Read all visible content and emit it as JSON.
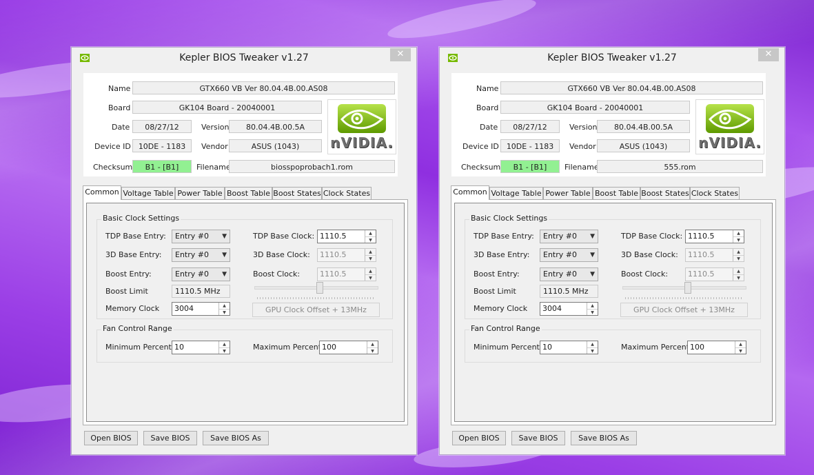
{
  "windows": [
    {
      "title": "Kepler BIOS Tweaker v1.27",
      "close_glyph": "✕",
      "info": {
        "name_label": "Name",
        "name_value": "GTX660 VB Ver 80.04.4B.00.AS08",
        "board_label": "Board",
        "board_value": "GK104 Board - 20040001",
        "date_label": "Date",
        "date_value": "08/27/12",
        "version_label": "Version",
        "version_value": "80.04.4B.00.5A",
        "device_label": "Device ID",
        "device_value": "10DE - 1183",
        "vendor_label": "Vendor",
        "vendor_value": "ASUS (1043)",
        "checksum_label": "Checksum",
        "checksum_value": "B1 - [B1]",
        "filename_label": "Filename",
        "filename_value": "biosspoprobach1.rom",
        "logo_text": "nVIDIA."
      },
      "tabs": [
        "Common",
        "Voltage Table",
        "Power Table",
        "Boost Table",
        "Boost States",
        "Clock States"
      ],
      "basic": {
        "group_title": "Basic Clock Settings",
        "tdp_entry_label": "TDP Base Entry:",
        "tdp_entry_value": "Entry #0",
        "base3d_entry_label": "3D Base Entry:",
        "base3d_entry_value": "Entry #0",
        "boost_entry_label": "Boost Entry:",
        "boost_entry_value": "Entry #0",
        "boost_limit_label": "Boost Limit",
        "boost_limit_value": "1110.5 MHz",
        "memory_clock_label": "Memory Clock",
        "memory_clock_value": "3004",
        "tdp_clock_label": "TDP Base Clock:",
        "tdp_clock_value": "1110.5",
        "base3d_clock_label": "3D Base Clock:",
        "base3d_clock_value": "1110.5",
        "boost_clock_label": "Boost Clock:",
        "boost_clock_value": "1110.5",
        "offset_button": "GPU Clock Offset + 13MHz"
      },
      "fan": {
        "group_title": "Fan Control Range",
        "min_label": "Minimum Percent:",
        "min_value": "10",
        "max_label": "Maximum Percent:",
        "max_value": "100"
      },
      "buttons": {
        "open": "Open BIOS",
        "save": "Save BIOS",
        "save_as": "Save BIOS As"
      }
    },
    {
      "title": "Kepler BIOS Tweaker v1.27",
      "close_glyph": "✕",
      "info": {
        "name_label": "Name",
        "name_value": "GTX660 VB Ver 80.04.4B.00.AS08",
        "board_label": "Board",
        "board_value": "GK104 Board - 20040001",
        "date_label": "Date",
        "date_value": "08/27/12",
        "version_label": "Version",
        "version_value": "80.04.4B.00.5A",
        "device_label": "Device ID",
        "device_value": "10DE - 1183",
        "vendor_label": "Vendor",
        "vendor_value": "ASUS (1043)",
        "checksum_label": "Checksum",
        "checksum_value": "B1 - [B1]",
        "filename_label": "Filename",
        "filename_value": "555.rom",
        "logo_text": "nVIDIA."
      },
      "tabs": [
        "Common",
        "Voltage Table",
        "Power Table",
        "Boost Table",
        "Boost States",
        "Clock States"
      ],
      "basic": {
        "group_title": "Basic Clock Settings",
        "tdp_entry_label": "TDP Base Entry:",
        "tdp_entry_value": "Entry #0",
        "base3d_entry_label": "3D Base Entry:",
        "base3d_entry_value": "Entry #0",
        "boost_entry_label": "Boost Entry:",
        "boost_entry_value": "Entry #0",
        "boost_limit_label": "Boost Limit",
        "boost_limit_value": "1110.5 MHz",
        "memory_clock_label": "Memory Clock",
        "memory_clock_value": "3004",
        "tdp_clock_label": "TDP Base Clock:",
        "tdp_clock_value": "1110.5",
        "base3d_clock_label": "3D Base Clock:",
        "base3d_clock_value": "1110.5",
        "boost_clock_label": "Boost Clock:",
        "boost_clock_value": "1110.5",
        "offset_button": "GPU Clock Offset + 13MHz"
      },
      "fan": {
        "group_title": "Fan Control Range",
        "min_label": "Minimum Percent:",
        "min_value": "10",
        "max_label": "Maximum Percent:",
        "max_value": "100"
      },
      "buttons": {
        "open": "Open BIOS",
        "save": "Save BIOS",
        "save_as": "Save BIOS As"
      }
    }
  ],
  "colors": {
    "checksum_ok": "#92f092",
    "nvidia_green": "#76b900",
    "desktop_purple": "#9b3fe6"
  }
}
